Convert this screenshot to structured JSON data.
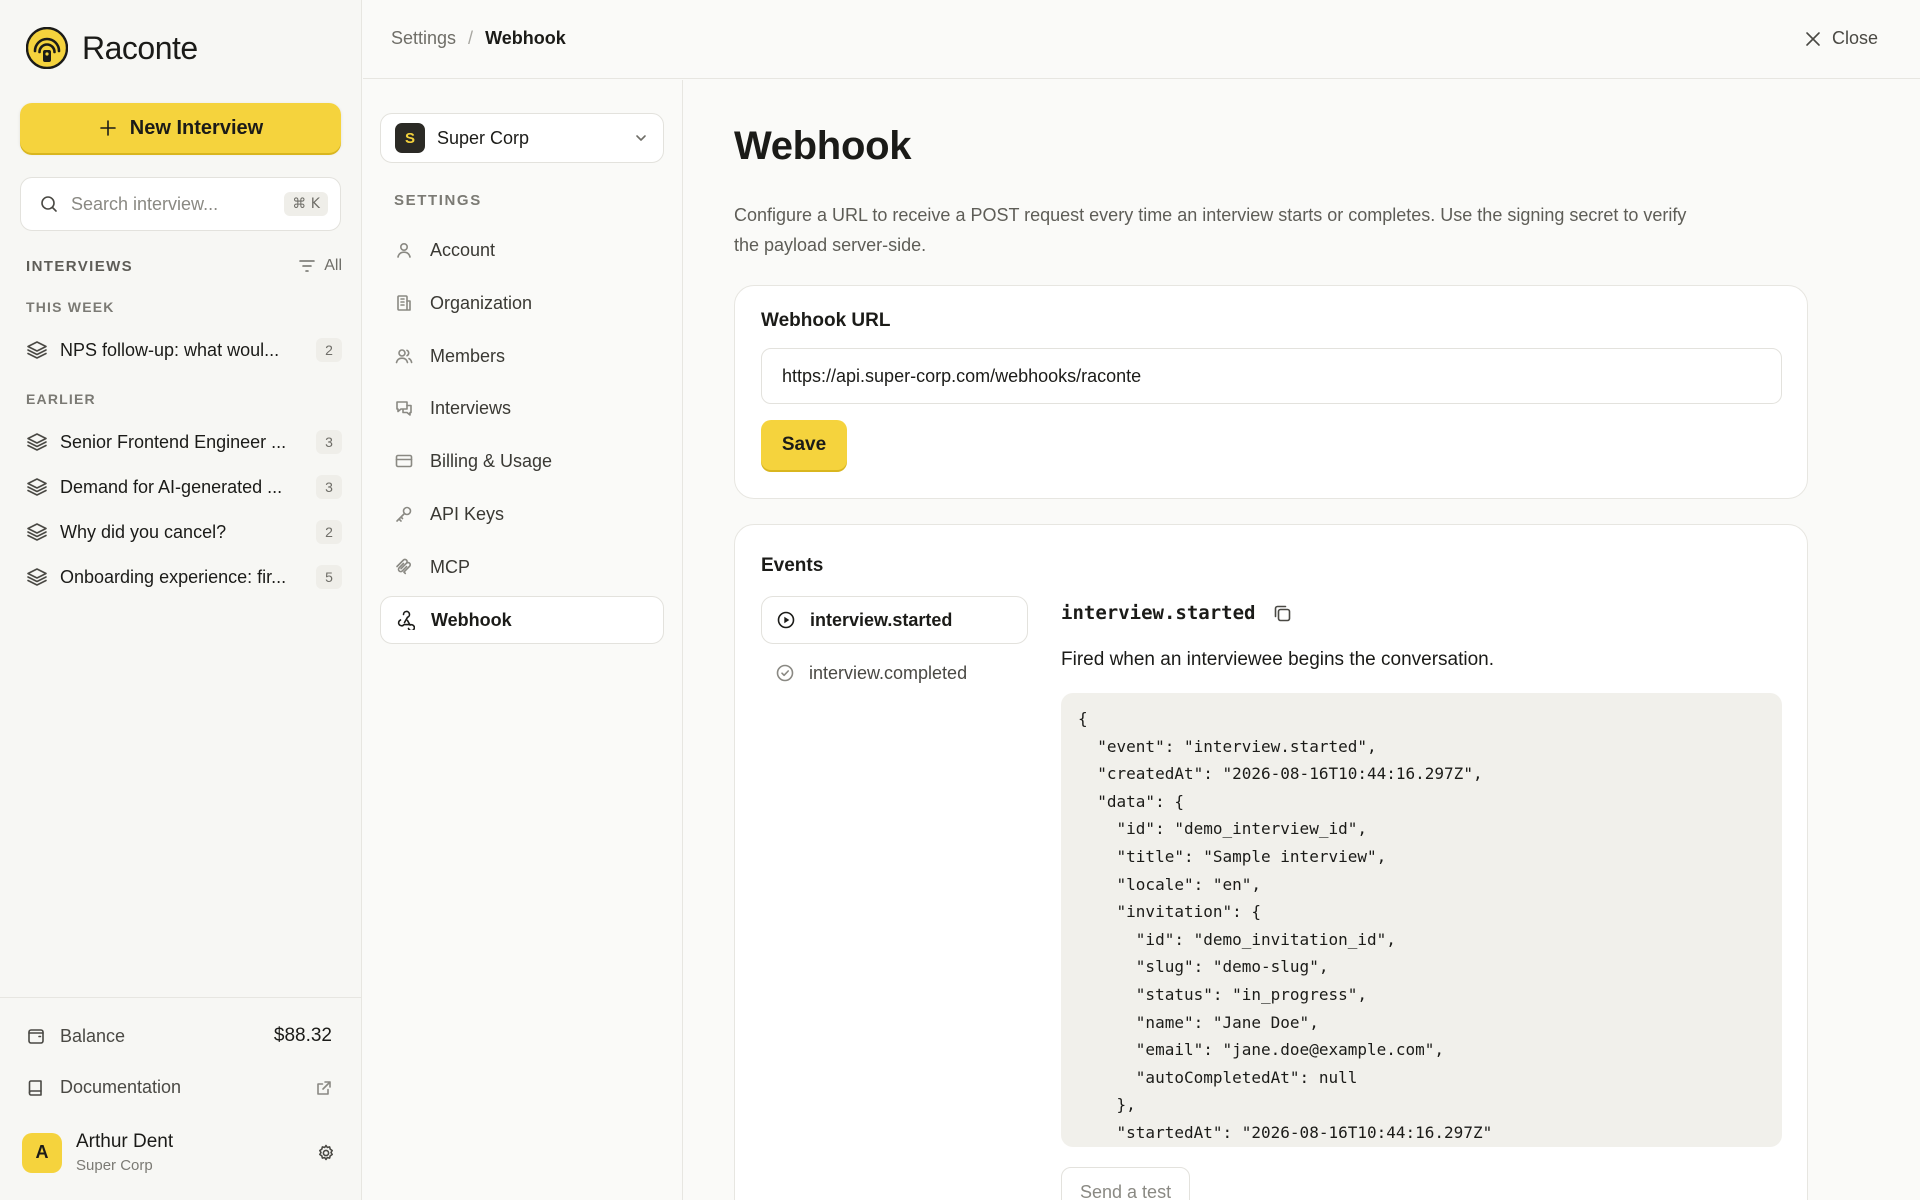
{
  "app": {
    "name": "Raconte"
  },
  "sidebar": {
    "new_button": "New Interview",
    "search": {
      "placeholder": "Search interview...",
      "shortcut": "⌘ K"
    },
    "section_title": "INTERVIEWS",
    "filter_label": "All",
    "groups": [
      {
        "label": "THIS WEEK",
        "items": [
          {
            "title": "NPS follow-up: what woul...",
            "count": "2"
          }
        ]
      },
      {
        "label": "EARLIER",
        "items": [
          {
            "title": "Senior Frontend Engineer ...",
            "count": "3"
          },
          {
            "title": "Demand for AI-generated ...",
            "count": "3"
          },
          {
            "title": "Why did you cancel?",
            "count": "2"
          },
          {
            "title": "Onboarding experience: fir...",
            "count": "5"
          }
        ]
      }
    ],
    "balance": {
      "label": "Balance",
      "value": "$88.32"
    },
    "documentation": {
      "label": "Documentation"
    },
    "user": {
      "initial": "A",
      "name": "Arthur Dent",
      "org": "Super Corp"
    }
  },
  "topbar": {
    "breadcrumb": [
      "Settings",
      "/",
      "Webhook"
    ],
    "close_label": "Close"
  },
  "settings_nav": {
    "org": {
      "initial": "S",
      "name": "Super Corp"
    },
    "label": "SETTINGS",
    "items": [
      {
        "label": "Account",
        "icon": "user-icon"
      },
      {
        "label": "Organization",
        "icon": "building-icon"
      },
      {
        "label": "Members",
        "icon": "users-icon"
      },
      {
        "label": "Interviews",
        "icon": "chat-icon"
      },
      {
        "label": "Billing & Usage",
        "icon": "card-icon"
      },
      {
        "label": "API Keys",
        "icon": "key-icon"
      },
      {
        "label": "MCP",
        "icon": "mcp-icon"
      },
      {
        "label": "Webhook",
        "icon": "webhook-icon",
        "active": true
      }
    ]
  },
  "main": {
    "title": "Webhook",
    "description": "Configure a URL to receive a POST request every time an interview starts or completes. Use the signing secret to verify the payload server-side.",
    "url_card": {
      "title": "Webhook URL",
      "url": "https://api.super-corp.com/webhooks/raconte",
      "save_label": "Save"
    },
    "events_card": {
      "title": "Events",
      "events": [
        {
          "label": "interview.started",
          "active": true
        },
        {
          "label": "interview.completed"
        }
      ],
      "selected_name": "interview.started",
      "selected_description": "Fired when an interviewee begins the conversation.",
      "payload": "{\n  \"event\": \"interview.started\",\n  \"createdAt\": \"2026-08-16T10:44:16.297Z\",\n  \"data\": {\n    \"id\": \"demo_interview_id\",\n    \"title\": \"Sample interview\",\n    \"locale\": \"en\",\n    \"invitation\": {\n      \"id\": \"demo_invitation_id\",\n      \"slug\": \"demo-slug\",\n      \"status\": \"in_progress\",\n      \"name\": \"Jane Doe\",\n      \"email\": \"jane.doe@example.com\",\n      \"autoCompletedAt\": null\n    },\n    \"startedAt\": \"2026-08-16T10:44:16.297Z\"",
      "send_test_label": "Send a test"
    }
  },
  "colors": {
    "accent": "#f5d33d",
    "background": "#fafaf8",
    "text": "#1b1b18"
  }
}
